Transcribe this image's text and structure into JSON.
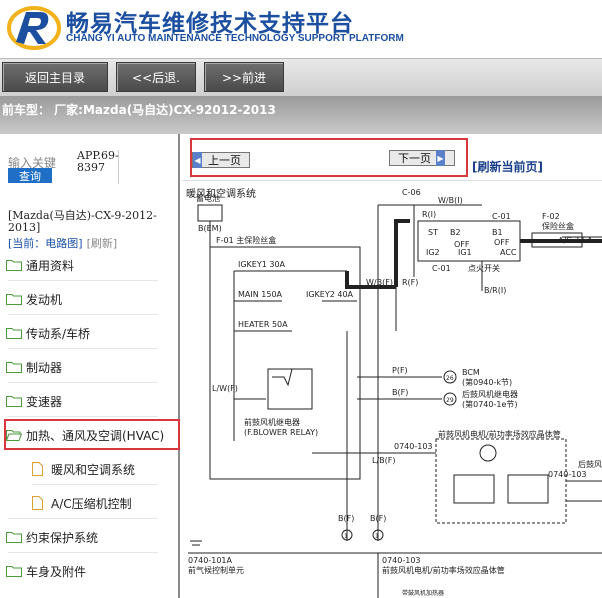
{
  "header": {
    "title_cn": "畅易汽车维修技术支持平台",
    "title_en": "CHANG YI AUTO MAINTENANCE TECHNOLOGY SUPPORT PLATFORM",
    "brand_color": "#1c4fa0"
  },
  "nav": {
    "home": "返回主目录",
    "back": "<<后退.",
    "forward": ">>前进"
  },
  "model_bar": {
    "text": "前车型： 厂家:Mazda(马自达)CX-92012-2013"
  },
  "search": {
    "label": "输入关键",
    "button": "查询",
    "app_code": "APP.69-8397"
  },
  "sidebar": {
    "model": "[Mazda(马自达)-CX-9-2012-2013]",
    "current_prefix": "[当前：电路图]",
    "refresh": "[刷新]",
    "items": [
      {
        "label": "通用资料"
      },
      {
        "label": "发动机"
      },
      {
        "label": "传动系/车桥"
      },
      {
        "label": "制动器"
      },
      {
        "label": "变速器"
      },
      {
        "label": "加热、通风及空调(HVAC)"
      },
      {
        "label": "暖风和空调系统"
      },
      {
        "label": "A/C压缩机控制"
      },
      {
        "label": "约束保护系统"
      },
      {
        "label": "车身及附件"
      }
    ]
  },
  "pager": {
    "prev": "上一页",
    "next": "下一页",
    "refresh": "[刷新当前页]"
  },
  "diagram": {
    "title": "暖风和空调系统",
    "labels": {
      "battery": "蓄电池",
      "fuse_box": "F-01 主保险丝盒",
      "igkey1": "IGKEY1 30A",
      "main": "MAIN 150A",
      "igkey2": "IGKEY2 40A",
      "heater": "HEATER 50A",
      "relay": "前鼓风机继电器",
      "relay_en": "(F.BLOWER RELAY)",
      "ignition": "点火开关",
      "c06": "C-06",
      "c01": "C-01",
      "c01b": "C-01",
      "f02": "F-02",
      "f02_desc": "保险丝盒",
      "ac": "A/C 7.5A",
      "bcm": "BCM",
      "bcm_sub": "(第0940-k节)",
      "rear_relay": "后鼓风机继电器",
      "rear_relay_sub": "(第0740-1e节)",
      "blower_motor": "前鼓风机电机/前功率场效应晶体管",
      "motor_ref": "0740-103",
      "motor_ref2": "0740-103",
      "rear": "后鼓风机",
      "bottom_left": "0740-101A",
      "bottom_left_desc": "前气候控制单元",
      "bottom_mid": "0740-103",
      "bottom_mid_desc": "前鼓风机电机/前功率场效应晶体管",
      "w_b": "W/B(I)",
      "r_i": "R(I)",
      "w_b2": "W/B(F)",
      "r_f": "R(F)",
      "br_i": "B/R(I)",
      "p_f": "P(F)",
      "b_f": "B(F)",
      "lw_f": "L/W(F)",
      "lb_f": "L/B(F)",
      "b_f2": "B(F)",
      "b_f3": "B(F)",
      "b_f4": "B(F)",
      "b_m": "B(EM)",
      "n26": "26",
      "n29": "29",
      "n1a": "1",
      "n1b": "1",
      "st": "ST",
      "ig2": "IG2",
      "ig1": "IG1",
      "acc": "ACC",
      "off1": "OFF",
      "off2": "OFF",
      "b2": "B2",
      "b1": "B1",
      "bottom_note": "带鼓风机加热器"
    }
  }
}
